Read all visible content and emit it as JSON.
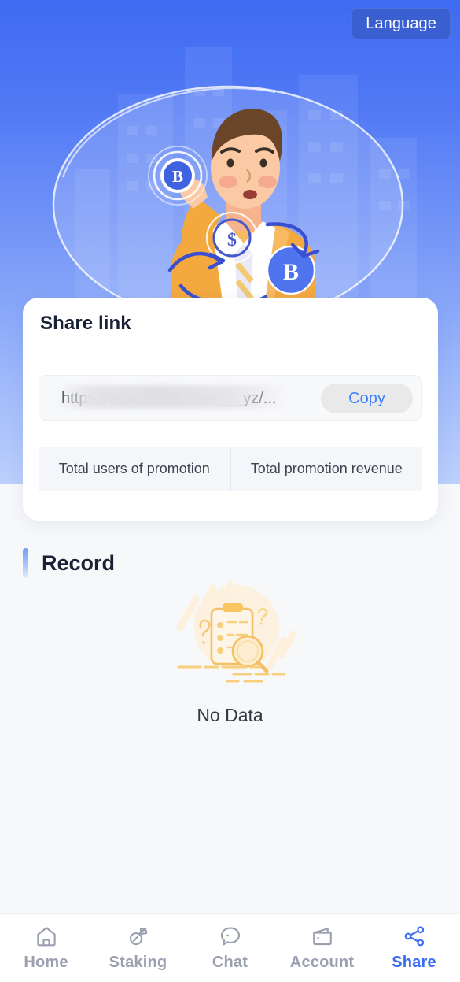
{
  "header": {
    "language_button": "Language"
  },
  "hero": {
    "illustration_name": "man-holding-bitcoin-coin-exchange-illustration"
  },
  "share_card": {
    "title": "Share link",
    "link_value": "https://www.coinbases___yz/...",
    "link_redacted": true,
    "copy_label": "Copy",
    "stats": [
      {
        "label": "Total users of promotion",
        "value": ""
      },
      {
        "label": "Total promotion revenue",
        "value": ""
      }
    ]
  },
  "record": {
    "title": "Record",
    "empty_text": "No Data",
    "empty_illustration": "clipboard-magnifier-no-data-icon"
  },
  "nav": {
    "items": [
      {
        "label": "Home",
        "icon": "home-icon",
        "active": false
      },
      {
        "label": "Staking",
        "icon": "pickaxe-icon",
        "active": false
      },
      {
        "label": "Chat",
        "icon": "chat-bubble-icon",
        "active": false
      },
      {
        "label": "Account",
        "icon": "wallet-icon",
        "active": false
      },
      {
        "label": "Share",
        "icon": "share-nodes-icon",
        "active": true
      }
    ]
  },
  "colors": {
    "hero_top": "#3f6bf2",
    "hero_bottom": "#bcd0fc",
    "accent_blue": "#3b6ef5",
    "copy_blue": "#3b7ffc",
    "page_bg": "#f7f8fa",
    "card_bg": "#ffffff",
    "empty_amber": "#f5c065"
  }
}
